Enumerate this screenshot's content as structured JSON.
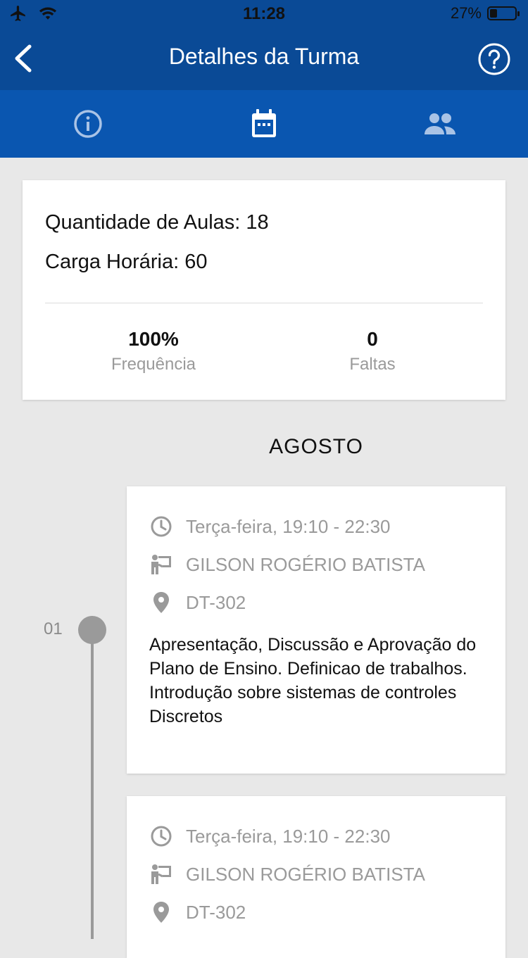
{
  "status_bar": {
    "time": "11:28",
    "battery_percent": "27%"
  },
  "navbar": {
    "title": "Detalhes da Turma"
  },
  "tabs": [
    {
      "icon": "info-icon",
      "active": false
    },
    {
      "icon": "calendar-icon",
      "active": true
    },
    {
      "icon": "people-icon",
      "active": false
    }
  ],
  "summary": {
    "classes_label": "Quantidade de Aulas: 18",
    "hours_label": "Carga Horária: 60",
    "attendance_value": "100%",
    "attendance_label": "Frequência",
    "absences_value": "0",
    "absences_label": "Faltas"
  },
  "month": "AGOSTO",
  "timeline": {
    "lessons": [
      {
        "number": "01",
        "schedule": "Terça-feira, 19:10 - 22:30",
        "teacher": "GILSON ROGÉRIO BATISTA",
        "room": "DT-302",
        "description": "Apresentação, Discussão e Aprovação do Plano de Ensino. Definicao de trabalhos. Introdução sobre sistemas de controles Discretos"
      },
      {
        "schedule": "Terça-feira, 19:10 - 22:30",
        "teacher": "GILSON ROGÉRIO BATISTA",
        "room": "DT-302"
      }
    ]
  },
  "colors": {
    "primary_dark": "#0a4a96",
    "primary": "#0a56b0",
    "background": "#e8e8e8",
    "muted": "#9a9a9a"
  }
}
